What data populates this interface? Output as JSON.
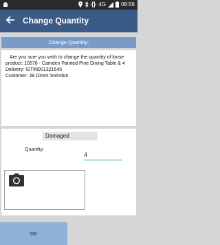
{
  "status_bar": {
    "time": "08:56",
    "network": "4G",
    "icons": [
      "android-icon",
      "location-icon",
      "bluetooth-icon",
      "vibrate-icon",
      "signal-icon",
      "battery-icon"
    ]
  },
  "app_bar": {
    "title": "Change Quantity",
    "back_icon": "back-arrow-icon"
  },
  "section_header": "Change Quantity:",
  "message": {
    "line1": "Are you sure you wish to change the quantity of loose",
    "line2": "product: 10578 - Camden Painted Pine Dining Table & 4",
    "line3": "Delivery: ISTIN001321545",
    "line4": "Customer: JB Direct Swindon"
  },
  "reason": "Damaged",
  "quantity": {
    "label": "Quantity:",
    "value": "4"
  },
  "photo": {
    "icon": "camera-icon"
  },
  "ok_label": "OK",
  "colors": {
    "app_bar": "#3b5a86",
    "section_header": "#7a9bc8",
    "ok_button": "#8eb1da",
    "input_underline": "#2e9c8c"
  }
}
